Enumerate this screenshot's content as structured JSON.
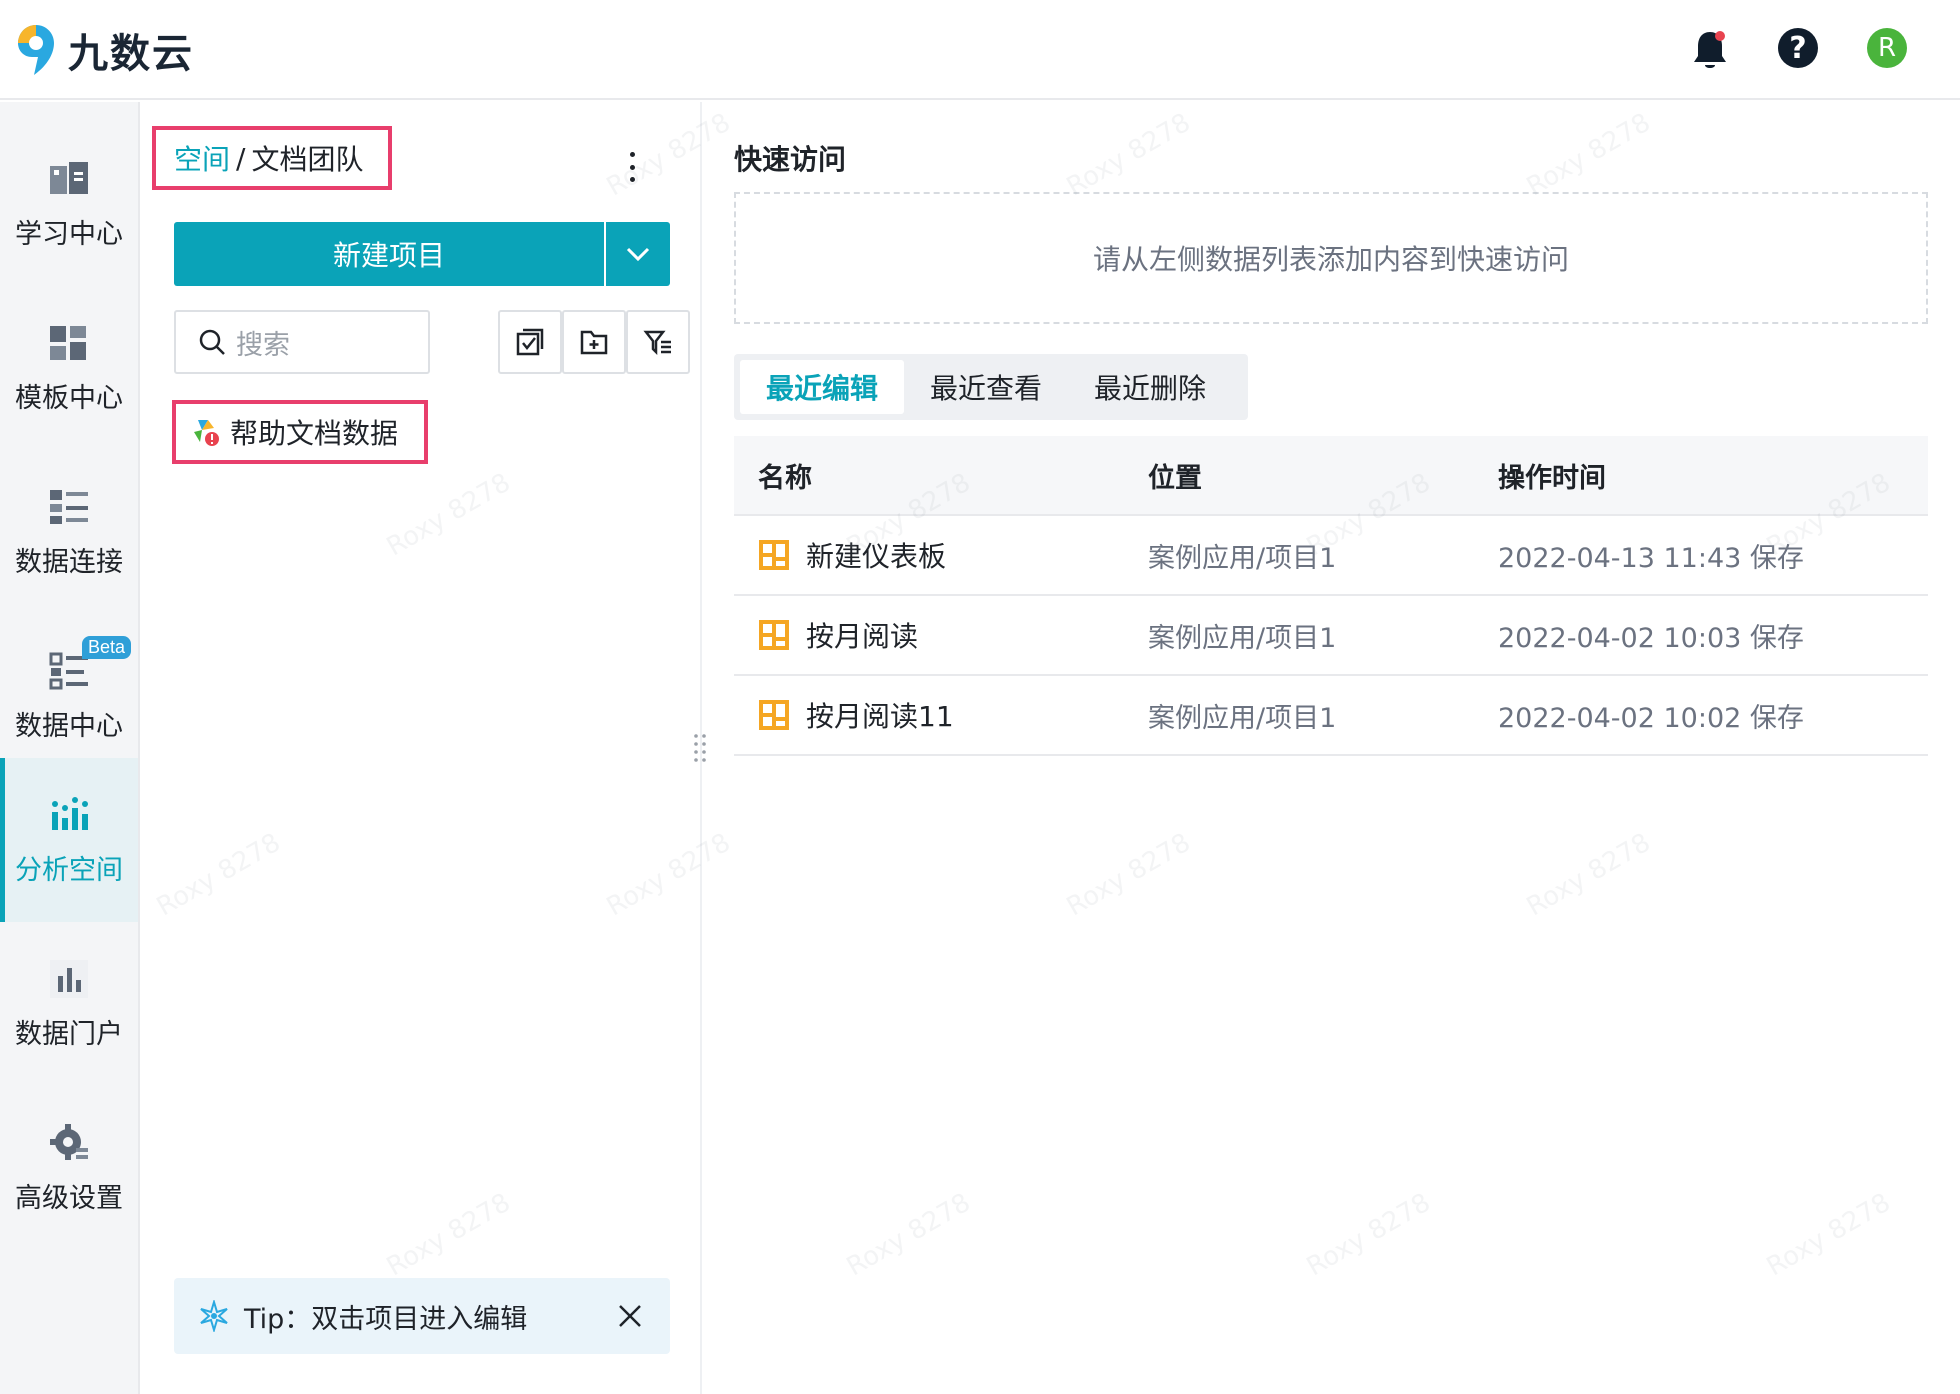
{
  "app": {
    "name": "九数云"
  },
  "topbar": {
    "icons": [
      "bell-icon",
      "help-icon",
      "user-avatar"
    ],
    "avatar_letter": "R",
    "accent": "#0aa3b8"
  },
  "leftnav": {
    "items": [
      {
        "label": "学习中心",
        "icon": "book-icon"
      },
      {
        "label": "模板中心",
        "icon": "template-icon"
      },
      {
        "label": "数据连接",
        "icon": "data-connect-icon"
      },
      {
        "label": "数据中心",
        "icon": "data-center-icon",
        "badge": "Beta"
      },
      {
        "label": "分析空间",
        "icon": "analysis-icon",
        "active": true
      },
      {
        "label": "数据门户",
        "icon": "portal-icon"
      },
      {
        "label": "高级设置",
        "icon": "settings-gear-icon"
      }
    ]
  },
  "panel": {
    "breadcrumb": {
      "root": "空间",
      "separator": "/",
      "current": "文档团队"
    },
    "new_button": "新建项目",
    "search_placeholder": "搜索",
    "tree_item": "帮助文档数据",
    "tip": "Tip：双击项目进入编辑"
  },
  "main": {
    "quick_access_title": "快速访问",
    "quick_access_empty": "请从左侧数据列表添加内容到快速访问",
    "tabs": [
      {
        "label": "最近编辑",
        "active": true
      },
      {
        "label": "最近查看"
      },
      {
        "label": "最近删除"
      }
    ],
    "table": {
      "headers": [
        "名称",
        "位置",
        "操作时间"
      ],
      "rows": [
        {
          "name": "新建仪表板",
          "location": "案例应用/项目1",
          "time": "2022-04-13 11:43 保存"
        },
        {
          "name": "按月阅读",
          "location": "案例应用/项目1",
          "time": "2022-04-02 10:03 保存"
        },
        {
          "name": "按月阅读11",
          "location": "案例应用/项目1",
          "time": "2022-04-02 10:02 保存"
        }
      ]
    }
  },
  "watermark": "Roxy 8278"
}
